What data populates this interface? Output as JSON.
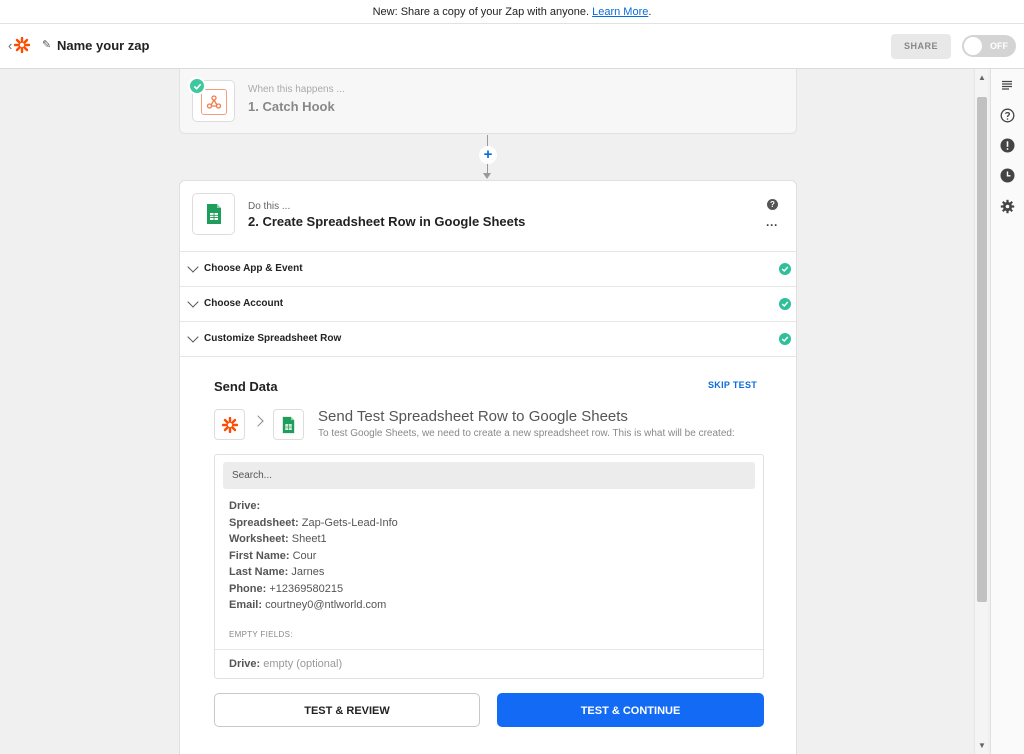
{
  "announcement": {
    "text": "New: Share a copy of your Zap with anyone.",
    "link": "Learn More",
    "suffix": "."
  },
  "header": {
    "zap_name": "Name your zap",
    "share_label": "SHARE",
    "toggle_label": "OFF"
  },
  "trigger": {
    "prefix": "When this happens ...",
    "title": "1. Catch Hook",
    "accent": "#3fc8a0"
  },
  "action": {
    "prefix": "Do this ...",
    "title": "2. Create Spreadsheet Row in Google Sheets",
    "help": "?",
    "more": "···",
    "sections": [
      {
        "label": "Choose App & Event"
      },
      {
        "label": "Choose Account"
      },
      {
        "label": "Customize Spreadsheet Row"
      }
    ]
  },
  "send": {
    "heading": "Send Data",
    "skip": "SKIP TEST",
    "title": "Send Test Spreadsheet Row to Google Sheets",
    "subtitle": "To test Google Sheets, we need to create a new spreadsheet row. This is what will be created:",
    "search_placeholder": "Search...",
    "fields": [
      {
        "key": "Drive:",
        "value": ""
      },
      {
        "key": "Spreadsheet:",
        "value": "Zap-Gets-Lead-Info"
      },
      {
        "key": "Worksheet:",
        "value": "Sheet1"
      },
      {
        "key": "First Name:",
        "value": "Cour"
      },
      {
        "key": "Last Name:",
        "value": "Jarnes"
      },
      {
        "key": "Phone:",
        "value": "+12369580215"
      },
      {
        "key": "Email:",
        "value": "courtney0@ntlworld.com"
      }
    ],
    "empty_heading": "EMPTY FIELDS:",
    "empty_field": {
      "key": "Drive:",
      "value": "empty (optional)"
    },
    "review_label": "TEST & REVIEW",
    "continue_label": "TEST & CONTINUE"
  },
  "colors": {
    "primary": "#136bf5",
    "success": "#2fbf9a",
    "zapier_orange": "#ff4a00",
    "sheets_green": "#1e9e5a"
  },
  "rail_icons": [
    "list-icon",
    "help-circle-icon",
    "alert-icon",
    "clock-icon",
    "gear-icon"
  ]
}
